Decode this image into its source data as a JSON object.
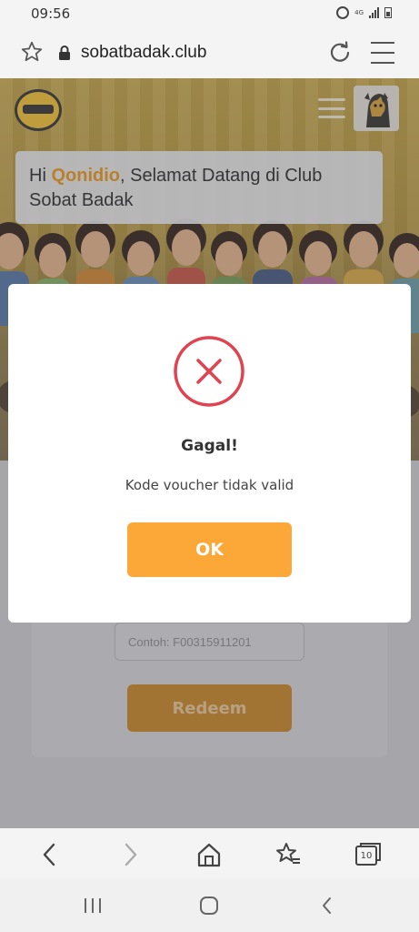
{
  "status_bar": {
    "time": "09:56",
    "network": "4G"
  },
  "browser": {
    "url": "sobatbadak.club"
  },
  "page": {
    "greeting_prefix": "Hi ",
    "user_name": "Qonidio",
    "greeting_suffix": ", Selamat Datang di Club Sobat Badak",
    "voucher_placeholder": "Contoh: F00315911201",
    "redeem_label": "Redeem"
  },
  "modal": {
    "title": "Gagal!",
    "message": "Kode voucher tidak valid",
    "ok_label": "OK"
  },
  "browser_nav": {
    "tabs_count": "10"
  },
  "colors": {
    "accent": "#fba838",
    "error": "#e0434f",
    "name_highlight": "#e89a23"
  }
}
